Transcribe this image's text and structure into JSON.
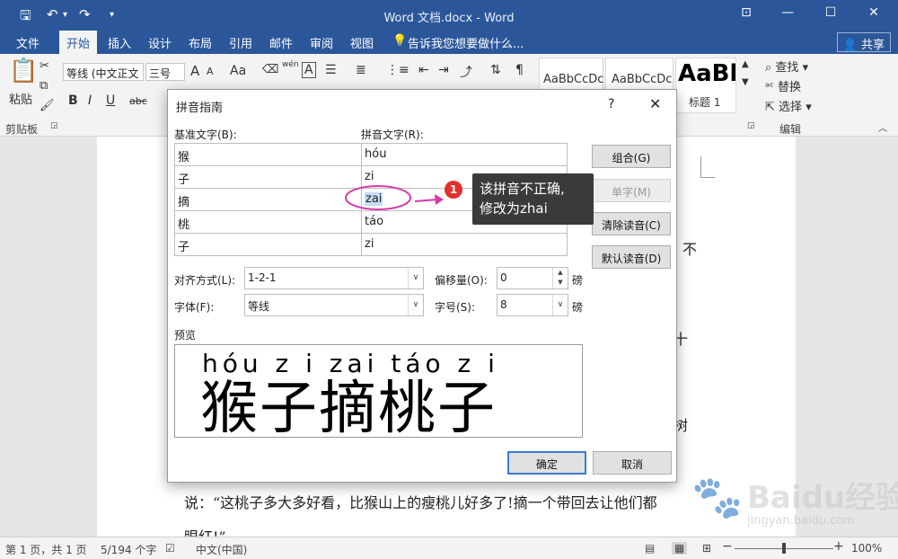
{
  "window": {
    "title": "Word 文档.docx - Word"
  },
  "tabs": [
    "文件",
    "开始",
    "插入",
    "设计",
    "布局",
    "引用",
    "邮件",
    "审阅",
    "视图"
  ],
  "tell_me": "告诉我您想要做什么...",
  "share": "共享",
  "ribbon": {
    "paste": "粘贴",
    "clipboard_group": "剪贴板",
    "font_name": "等线 (中文正文",
    "font_size": "三号",
    "font_grow": "A",
    "font_shrink": "A",
    "aa": "Aa",
    "wen": "wén",
    "bold": "B",
    "italic": "I",
    "underline": "U",
    "strike": "abc",
    "style1": "AaBbCcDc",
    "style2": "AaBbCcDc",
    "style3": "AaBl",
    "style3_label": "标题 1",
    "find": "查找",
    "replace": "替换",
    "select": "选择",
    "edit_group": "编辑"
  },
  "document": {
    "line1": "说：“这桃子多大多好看，比猴山上的瘦桃儿好多了!摘一个带回去让他们都",
    "line2": "眼红!”",
    "frag_bu": "不",
    "frag_shi": "十",
    "frag_shu": "树",
    "frag_ji": "↓"
  },
  "dialog": {
    "title": "拼音指南",
    "help": "?",
    "base_header": "基准文字(B):",
    "ruby_header": "拼音文字(R):",
    "rows": [
      {
        "base": "猴",
        "ruby": "hóu"
      },
      {
        "base": "子",
        "ruby": "zi"
      },
      {
        "base": "摘",
        "ruby": "zai"
      },
      {
        "base": "桃",
        "ruby": "táo"
      },
      {
        "base": "子",
        "ruby": "zi"
      }
    ],
    "btn_group": "组合(G)",
    "btn_single": "单字(M)",
    "btn_clear": "清除读音(C)",
    "btn_default": "默认读音(D)",
    "align_label": "对齐方式(L):",
    "align_value": "1-2-1",
    "offset_label": "偏移量(O):",
    "offset_value": "0",
    "offset_unit": "磅",
    "font_label": "字体(F):",
    "font_value": "等线",
    "size_label": "字号(S):",
    "size_value": "8",
    "size_unit": "磅",
    "preview_label": "预览",
    "preview_pinyin": "hóu z i zai táo z i",
    "preview_hanzi": "猴子摘桃子",
    "ok": "确定",
    "cancel": "取消"
  },
  "annotation": {
    "badge": "1",
    "line1": "该拼音不正确,",
    "line2": "修改为zhai"
  },
  "status": {
    "page": "第 1 页，共 1 页",
    "words": "5/194 个字",
    "lang": "中文(中国)",
    "zoom": "100%",
    "zoom_level": 1.0
  },
  "watermark": {
    "brand": "Baidu经验",
    "url": "jingyan.baidu.com"
  },
  "colors": {
    "word_blue": "#2b579a",
    "highlight": "#c5dcf5",
    "callout_bg": "#3a3a3a",
    "badge": "#e2312d",
    "ellipse": "#d63aa8"
  }
}
